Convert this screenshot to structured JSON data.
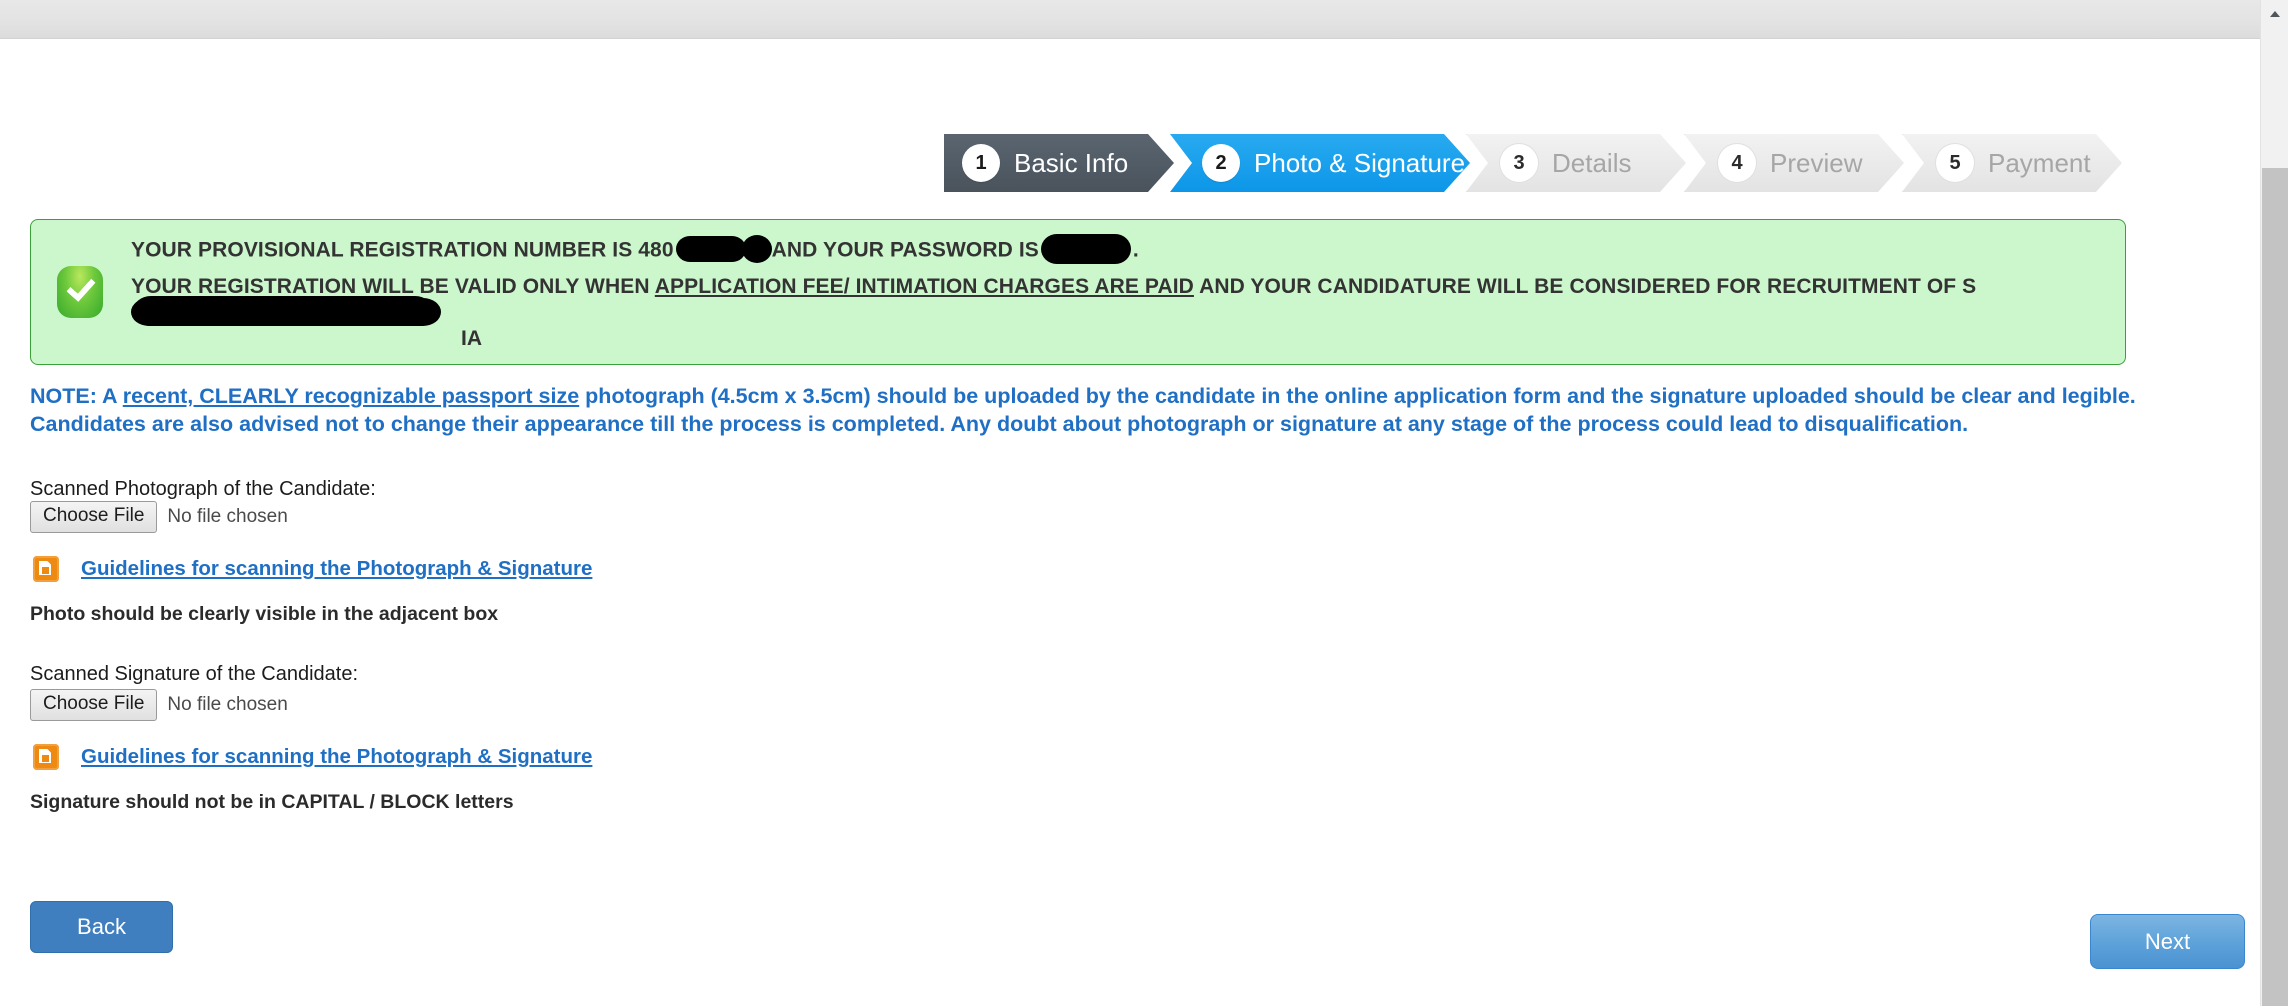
{
  "wizard": {
    "steps": [
      {
        "number": "1",
        "label": "Basic Info",
        "state": "done"
      },
      {
        "number": "2",
        "label": "Photo & Signature",
        "state": "current"
      },
      {
        "number": "3",
        "label": "Details",
        "state": "todo"
      },
      {
        "number": "4",
        "label": "Preview",
        "state": "todo"
      },
      {
        "number": "5",
        "label": "Payment",
        "state": "todo"
      }
    ],
    "current_chevron": "»"
  },
  "alert": {
    "icon": "success-check-icon",
    "line1_part1": "YOUR PROVISIONAL REGISTRATION NUMBER IS 480",
    "line1_part2": "AND YOUR PASSWORD IS",
    "line1_part3": ".",
    "line2_part1": "YOUR REGISTRATION WILL BE VALID ONLY WHEN ",
    "line2_underlined": "APPLICATION FEE/ INTIMATION CHARGES ARE PAID",
    "line2_part2": " AND YOUR CANDIDATURE WILL BE CONSIDERED FOR RECRUITMENT OF S",
    "line2_tail": "IA",
    "background_color": "#ccf7cc",
    "border_color": "#3aa03a"
  },
  "note": {
    "prefix": "NOTE: A ",
    "underlined": "recent, CLEARLY recognizable passport size",
    "rest": " photograph (4.5cm x 3.5cm) should be uploaded by the candidate in the online application form and the signature uploaded should be clear and legible. Candidates are also advised not to change their appearance till the process is completed. Any doubt about photograph or signature at any stage of the process could lead to disqualification.",
    "color": "#1f6fc4"
  },
  "photo_section": {
    "label": "Scanned Photograph of the Candidate:",
    "choose_file_label": "Choose File",
    "file_status": "No file chosen",
    "guideline_link": "Guidelines for scanning the Photograph & Signature",
    "guideline_icon": "pdf-file-icon",
    "hint": "Photo should be clearly visible in the adjacent box"
  },
  "signature_section": {
    "label": "Scanned Signature of the Candidate:",
    "choose_file_label": "Choose File",
    "file_status": "No file chosen",
    "guideline_link": "Guidelines for scanning the Photograph & Signature",
    "guideline_icon": "pdf-file-icon",
    "hint": "Signature should not be in CAPITAL / BLOCK letters"
  },
  "footer": {
    "back_label": "Back",
    "next_label": "Next",
    "back_color": "#3f7fbf",
    "next_color": "#5fa3da"
  }
}
